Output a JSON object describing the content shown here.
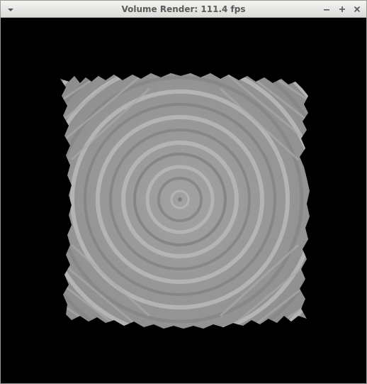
{
  "window": {
    "title": "Volume Render: 111.4 fps",
    "background": "#000000",
    "titlebar_text_color": "#5a5a58"
  },
  "controls": {
    "window_menu_icon": "chevron-down-icon",
    "minimize_icon": "minimize-icon",
    "maximize_icon": "maximize-icon",
    "close_icon": "close-icon"
  },
  "render": {
    "volume_color": "#9a9a9a",
    "ring_color": "#b3b3b3"
  }
}
